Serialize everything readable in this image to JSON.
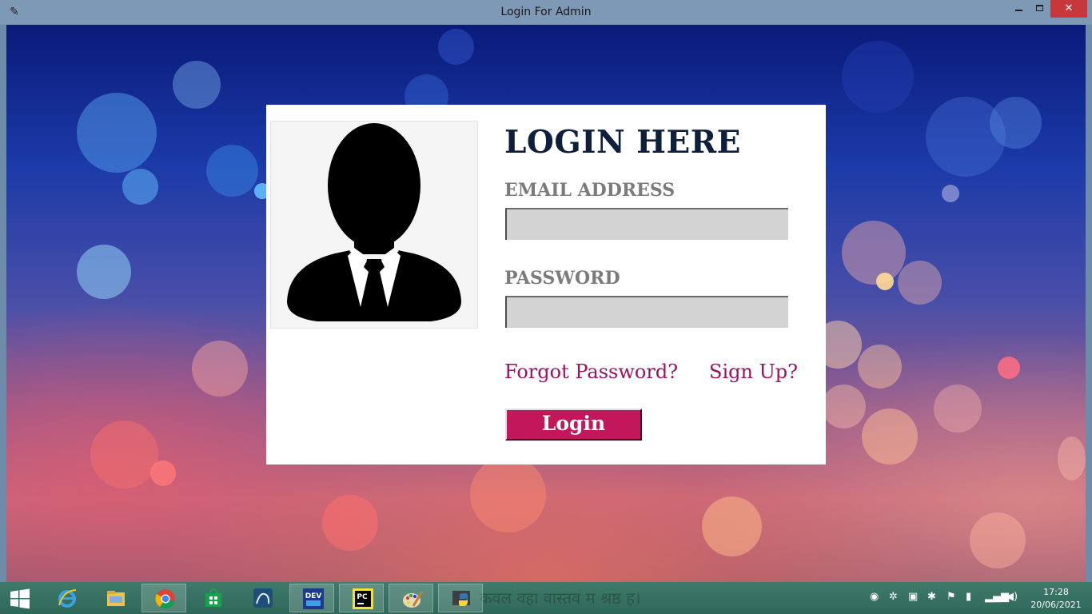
{
  "window": {
    "title": "Login For Admin",
    "app_icon": "feather-icon",
    "close_label": "✕"
  },
  "login": {
    "heading": "LOGIN HERE",
    "email_label": "EMAIL ADDRESS",
    "email_value": "",
    "password_label": "PASSWORD",
    "password_value": "",
    "forgot_link": "Forgot Password?",
    "signup_link": "Sign Up?",
    "login_button": "Login",
    "avatar_icon": "user-silhouette-icon"
  },
  "colors": {
    "accent": "#c2185b",
    "link": "#a01060",
    "heading": "#0e1f3c",
    "label": "#7b7b7b",
    "field_bg": "#d3d3d3"
  },
  "taskbar": {
    "apps": [
      {
        "name": "start-icon"
      },
      {
        "name": "internet-explorer-icon"
      },
      {
        "name": "file-explorer-icon"
      },
      {
        "name": "chrome-icon"
      },
      {
        "name": "store-icon"
      },
      {
        "name": "mysql-workbench-icon"
      },
      {
        "name": "dev-cpp-icon",
        "label": "DEV"
      },
      {
        "name": "pycharm-icon",
        "label": "PC"
      },
      {
        "name": "paint-icon"
      },
      {
        "name": "python-icon"
      }
    ],
    "background_text": "कवल वहा वास्तव म श्रष्ठ ह।",
    "clock_time": "17:28",
    "clock_date": "20/06/2021"
  }
}
